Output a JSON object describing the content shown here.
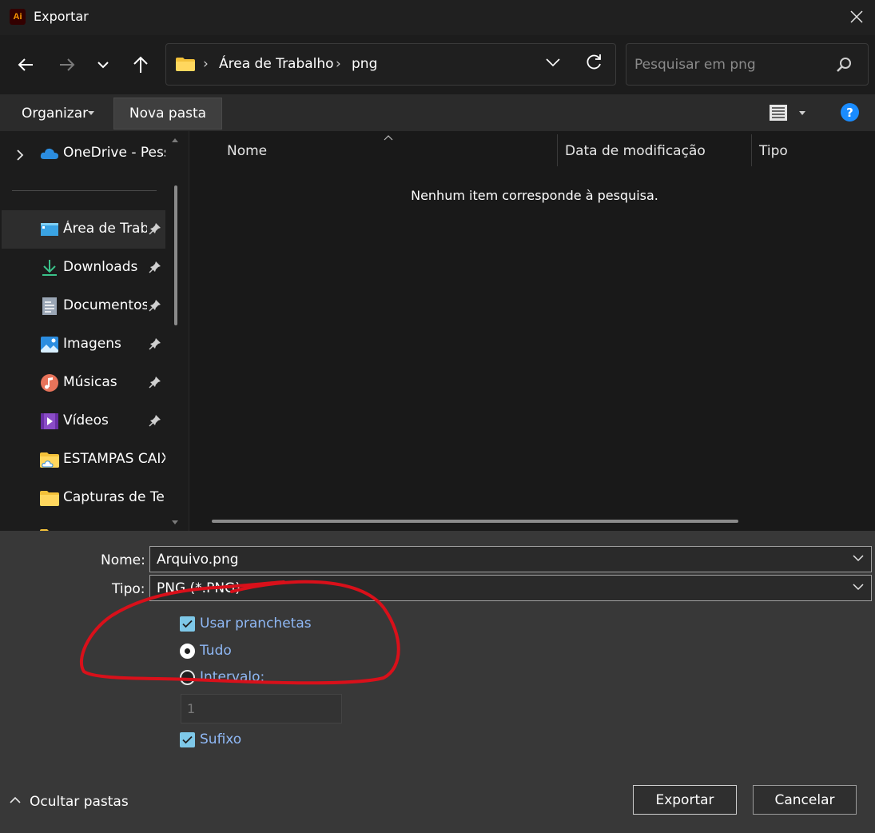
{
  "window": {
    "title": "Exportar",
    "app_icon_text": "Ai",
    "app_icon_color": "#ff9a00"
  },
  "navigation": {
    "back_icon": "arrow-left-icon",
    "forward_icon": "arrow-right-icon",
    "recent_icon": "chevron-down-icon",
    "up_icon": "arrow-up-icon"
  },
  "address": {
    "crumbs": [
      "Área de Trabalho",
      "png"
    ],
    "separator": "›"
  },
  "search": {
    "placeholder": "Pesquisar em png"
  },
  "toolbar": {
    "organize_label": "Organizar",
    "new_folder_label": "Nova pasta",
    "help_label": "?",
    "help_color": "#1a8cff"
  },
  "sidebar": {
    "items": [
      {
        "label": "OneDrive - Pessoal",
        "icon": "onedrive-cloud-icon",
        "pinned": false
      },
      {
        "label": "Área de Trabalho",
        "icon": "desktop-icon",
        "pinned": true,
        "selected": true
      },
      {
        "label": "Downloads",
        "icon": "download-icon",
        "pinned": true
      },
      {
        "label": "Documentos",
        "icon": "document-icon",
        "pinned": true
      },
      {
        "label": "Imagens",
        "icon": "pictures-icon",
        "pinned": true
      },
      {
        "label": "Músicas",
        "icon": "music-icon",
        "pinned": true
      },
      {
        "label": "Vídeos",
        "icon": "video-icon",
        "pinned": true
      },
      {
        "label": "ESTAMPAS CAIXA",
        "icon": "cloud-folder-icon",
        "pinned": false
      },
      {
        "label": "Capturas de Tela",
        "icon": "folder-icon",
        "pinned": false
      }
    ]
  },
  "file_list": {
    "columns": [
      "Nome",
      "Data de modificação",
      "Tipo"
    ],
    "empty_message": "Nenhum item corresponde à pesquisa."
  },
  "form": {
    "name_label": "Nome:",
    "name_value": "Arquivo.png",
    "type_label": "Tipo:",
    "type_value": "PNG (*.PNG)",
    "use_artboards_label": "Usar pranchetas",
    "use_artboards_checked": true,
    "all_label": "Tudo",
    "all_selected": true,
    "range_label": "Intervalo:",
    "range_selected": false,
    "range_value": "1",
    "suffix_label": "Sufixo",
    "suffix_checked": true,
    "accent_color": "#7ec8e8"
  },
  "footer": {
    "hide_folders_label": "Ocultar pastas",
    "export_label": "Exportar",
    "cancel_label": "Cancelar"
  },
  "annotation_color": "#d9101a"
}
